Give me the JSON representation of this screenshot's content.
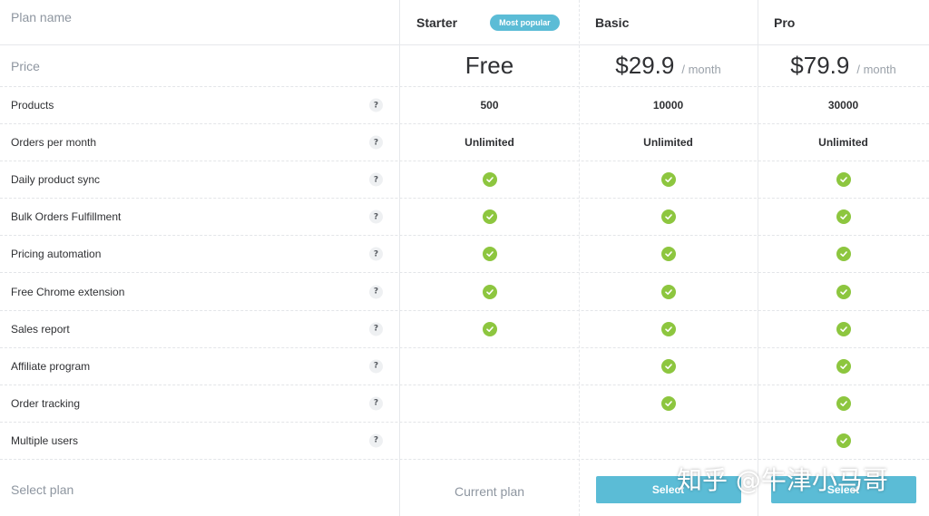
{
  "header": {
    "label": "Plan name",
    "plans": [
      {
        "name": "Starter",
        "badge": "Most popular"
      },
      {
        "name": "Basic"
      },
      {
        "name": "Pro"
      }
    ]
  },
  "price": {
    "label": "Price",
    "plans": [
      {
        "amount": "Free",
        "per": ""
      },
      {
        "amount": "$29.9",
        "per": "/ month"
      },
      {
        "amount": "$79.9",
        "per": "/ month"
      }
    ]
  },
  "features": [
    {
      "label": "Products",
      "help": "?",
      "values": [
        "500",
        "10000",
        "30000"
      ]
    },
    {
      "label": "Orders per month",
      "help": "?",
      "values": [
        "Unlimited",
        "Unlimited",
        "Unlimited"
      ]
    },
    {
      "label": "Daily product sync",
      "help": "?",
      "values": [
        true,
        true,
        true
      ]
    },
    {
      "label": "Bulk Orders Fulfillment",
      "help": "?",
      "values": [
        true,
        true,
        true
      ]
    },
    {
      "label": "Pricing automation",
      "help": "?",
      "values": [
        true,
        true,
        true
      ]
    },
    {
      "label": "Free Chrome extension",
      "help": "?",
      "values": [
        true,
        true,
        true
      ]
    },
    {
      "label": "Sales report",
      "help": "?",
      "values": [
        true,
        true,
        true
      ]
    },
    {
      "label": "Affiliate program",
      "help": "?",
      "values": [
        false,
        true,
        true
      ]
    },
    {
      "label": "Order tracking",
      "help": "?",
      "values": [
        false,
        true,
        true
      ]
    },
    {
      "label": "Multiple users",
      "help": "?",
      "values": [
        false,
        false,
        true
      ]
    }
  ],
  "footer": {
    "label": "Select plan",
    "current_label": "Current plan",
    "select_label": "Select"
  },
  "watermark": "知乎 @牛津小马哥",
  "colors": {
    "accent": "#5bbcd6",
    "check": "#8dc63f"
  }
}
